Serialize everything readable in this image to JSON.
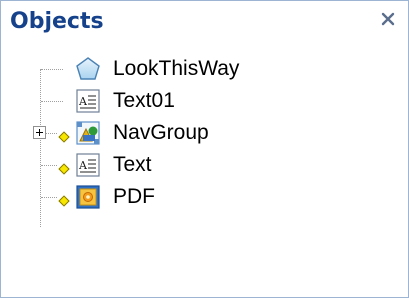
{
  "panel": {
    "title": "Objects",
    "close_glyph": "×"
  },
  "tree": {
    "items": [
      {
        "label": "LookThisWay",
        "icon": "pentagon-icon",
        "expandable": false,
        "has_marker": false
      },
      {
        "label": "Text01",
        "icon": "text-object-icon",
        "expandable": false,
        "has_marker": false
      },
      {
        "label": "NavGroup",
        "icon": "group-icon",
        "expandable": true,
        "has_marker": true
      },
      {
        "label": "Text",
        "icon": "text-object-icon",
        "expandable": false,
        "has_marker": true
      },
      {
        "label": "PDF",
        "icon": "pdf-object-icon",
        "expandable": false,
        "has_marker": true
      }
    ]
  },
  "colors": {
    "title": "#15428b",
    "border": "#9db4d2",
    "marker": "#f7e600",
    "tree_line": "#a0a0a0"
  }
}
